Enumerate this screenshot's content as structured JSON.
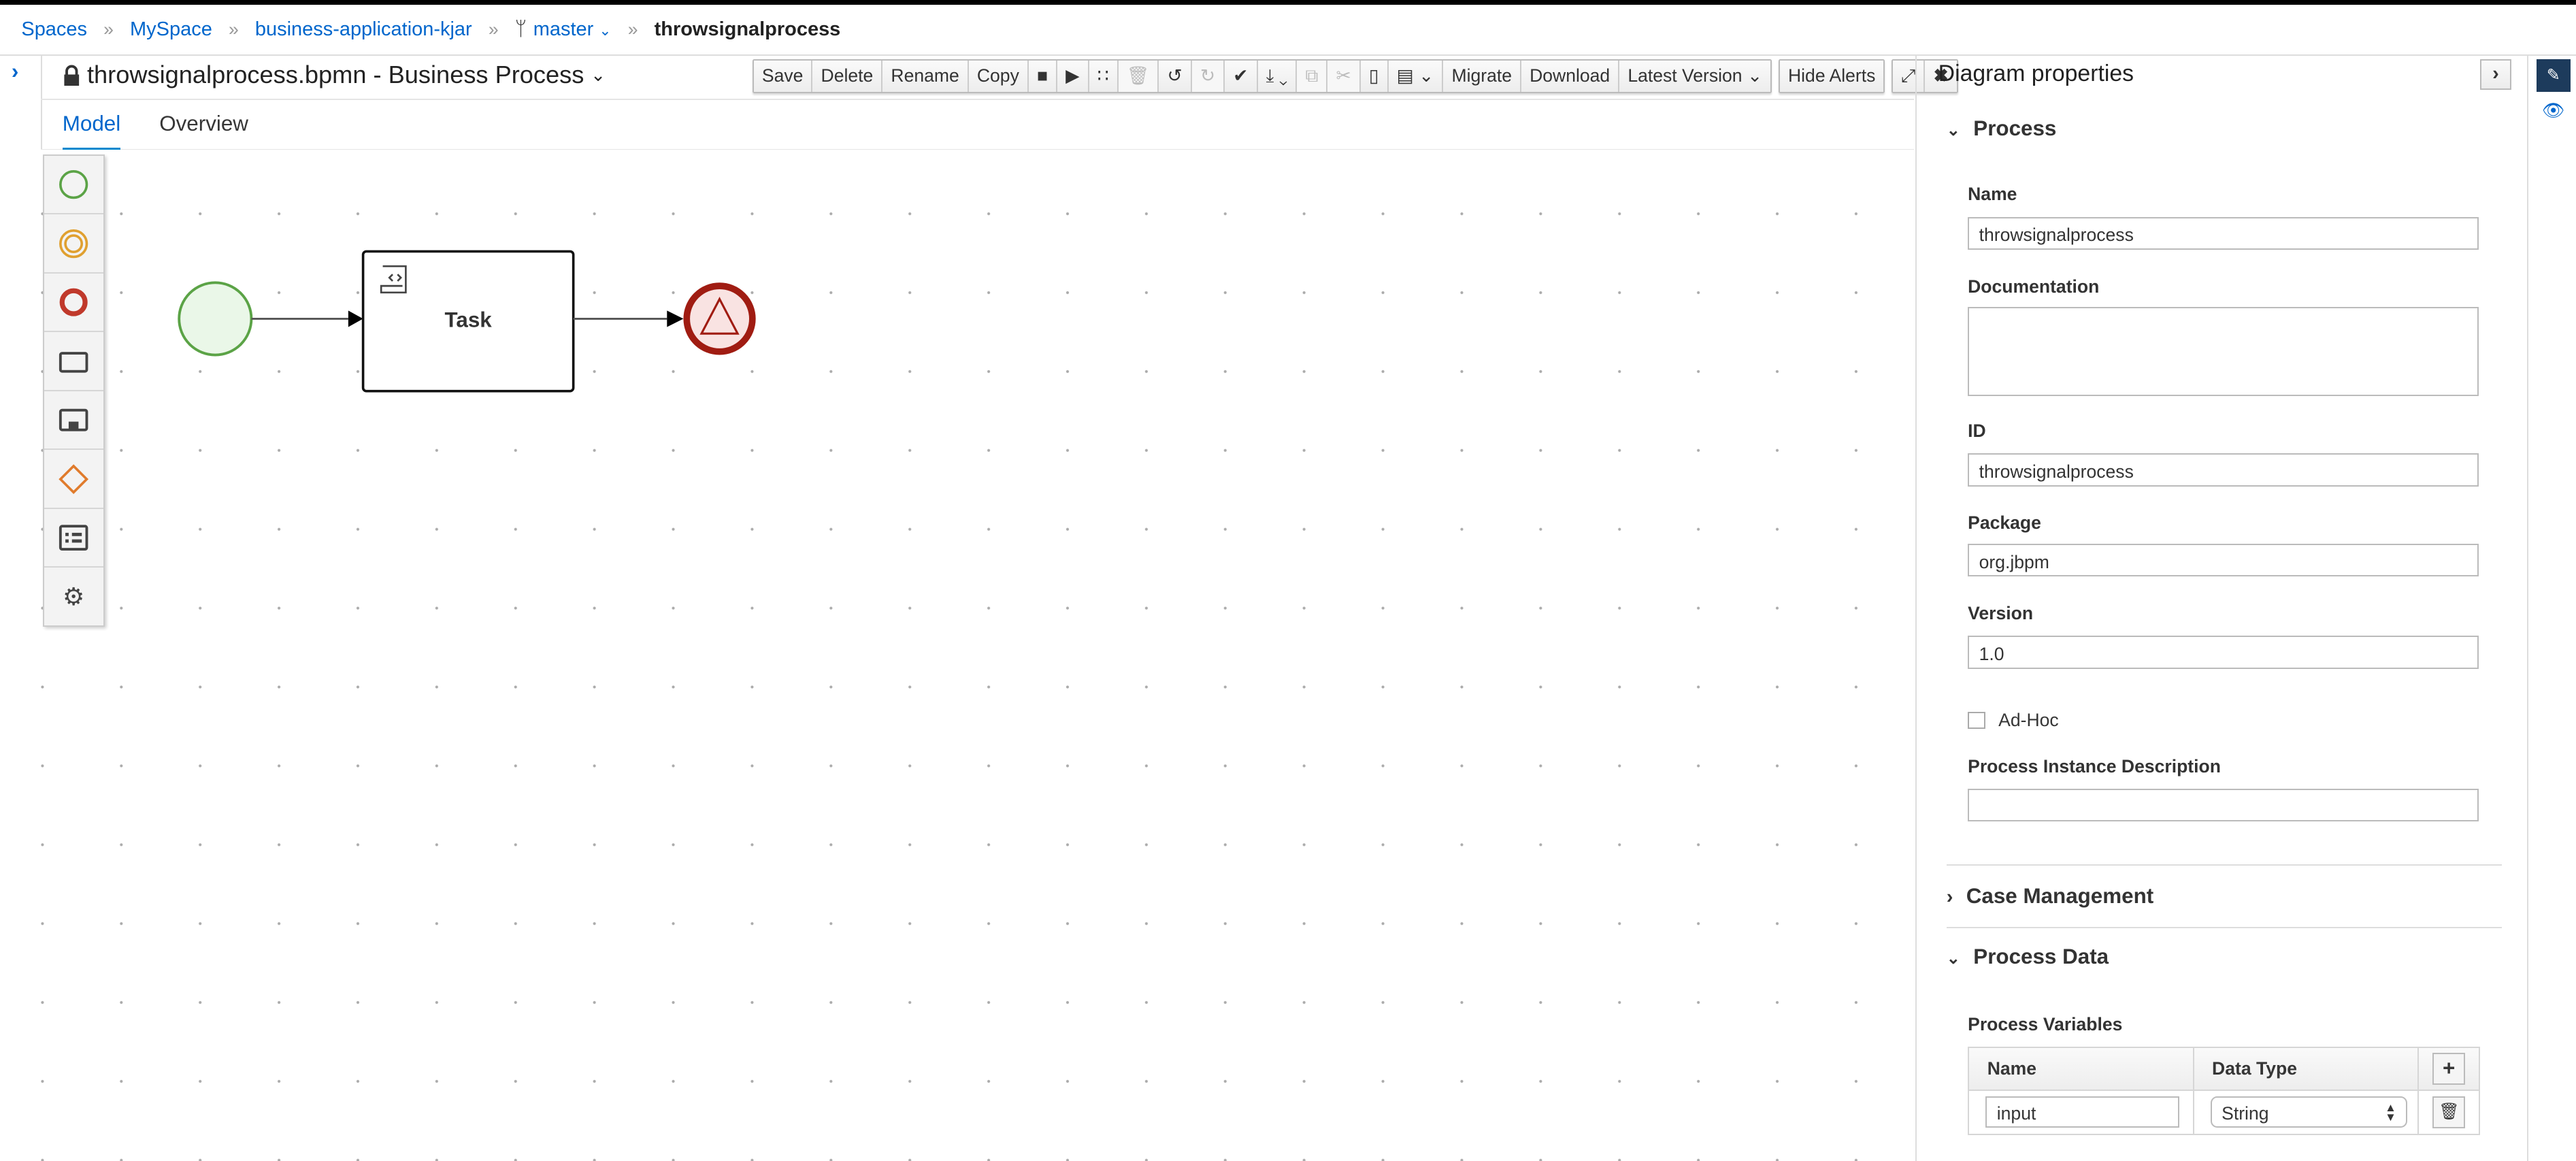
{
  "breadcrumb": {
    "items": [
      "Spaces",
      "MySpace",
      "business-application-kjar"
    ],
    "branch": "master",
    "current": "throwsignalprocess",
    "separator": "»"
  },
  "editor": {
    "title": "throwsignalprocess.bpmn - Business Process"
  },
  "toolbar": {
    "save": "Save",
    "delete": "Delete",
    "rename": "Rename",
    "copy": "Copy",
    "migrate": "Migrate",
    "download": "Download",
    "latest_version": "Latest Version",
    "hide_alerts": "Hide Alerts"
  },
  "tabs": {
    "model": "Model",
    "overview": "Overview"
  },
  "diagram": {
    "task_label": "Task",
    "colors": {
      "start": "#5ba346",
      "end": "#a01c12",
      "intermediate": "#e0a030",
      "gateway": "#e07b2c"
    }
  },
  "properties": {
    "title": "Diagram properties",
    "process_section": "Process",
    "name_label": "Name",
    "name_value": "throwsignalprocess",
    "documentation_label": "Documentation",
    "documentation_value": "",
    "id_label": "ID",
    "id_value": "throwsignalprocess",
    "package_label": "Package",
    "package_value": "org.jbpm",
    "version_label": "Version",
    "version_value": "1.0",
    "adhoc_label": "Ad-Hoc",
    "pid_label": "Process Instance Description",
    "pid_value": "",
    "case_section": "Case Management",
    "data_section": "Process Data",
    "variables_label": "Process Variables",
    "var_col_name": "Name",
    "var_col_type": "Data Type",
    "variables": [
      {
        "name": "input",
        "type": "String"
      }
    ]
  }
}
